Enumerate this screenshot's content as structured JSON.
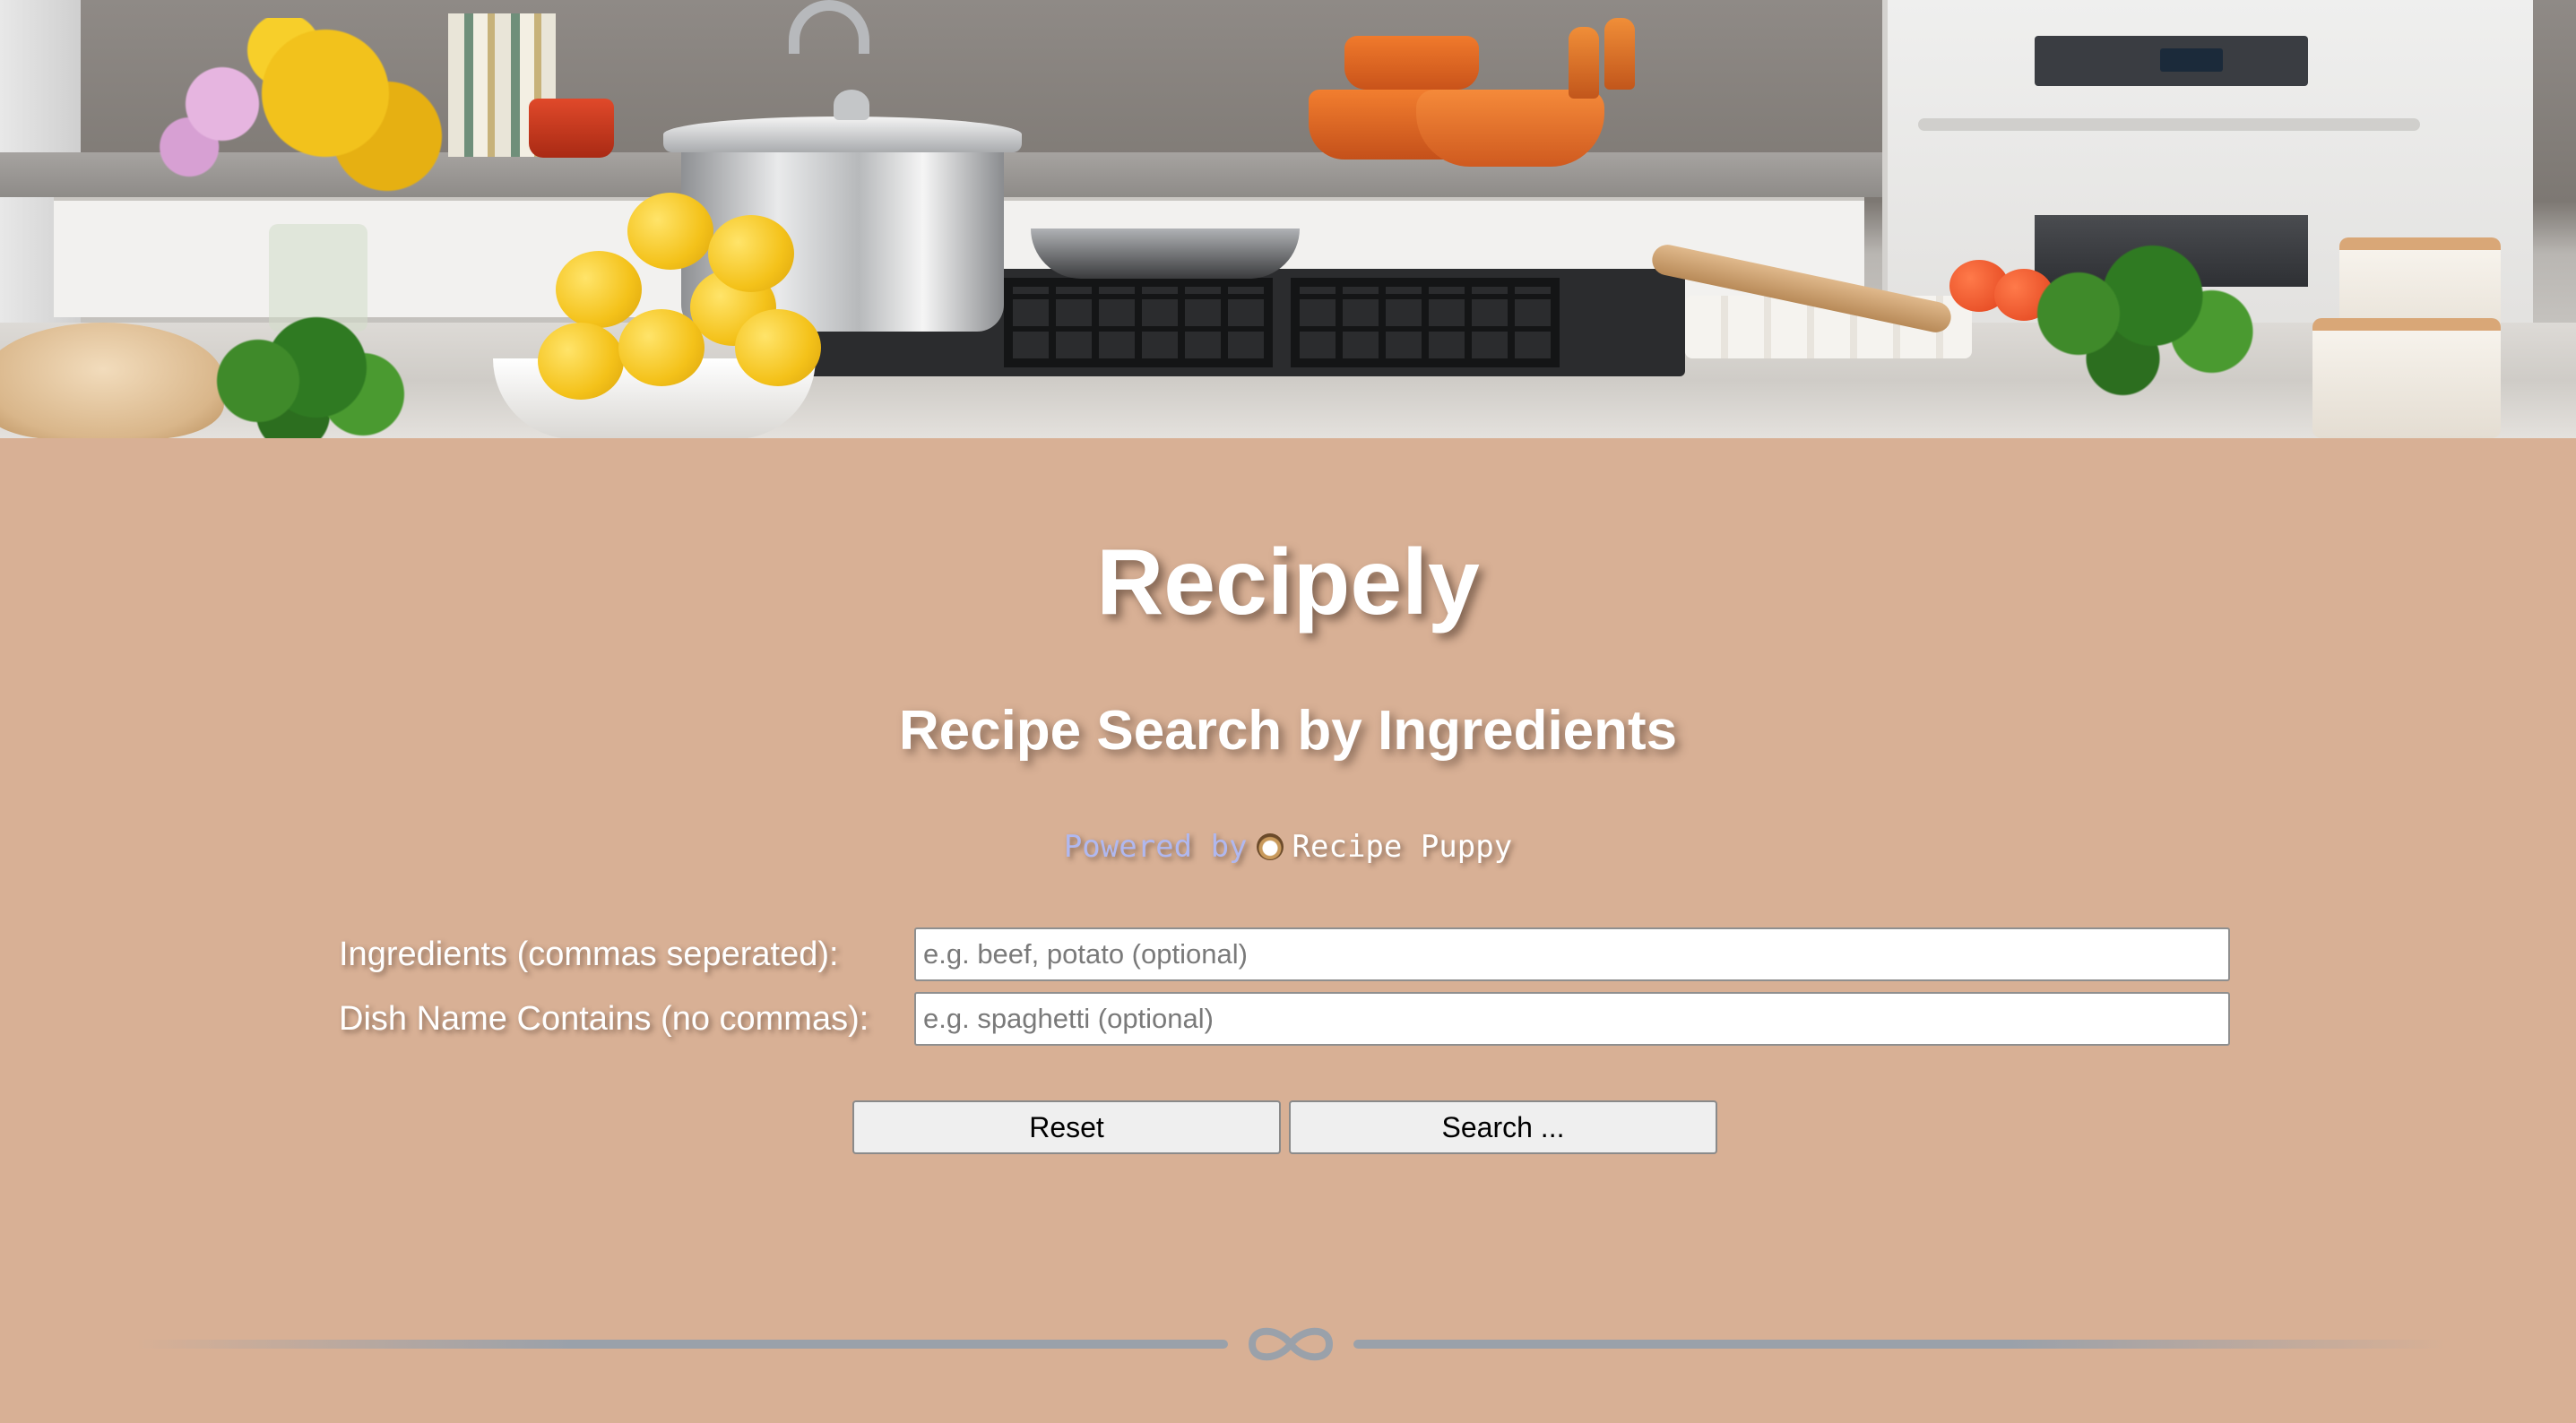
{
  "app": {
    "title": "Recipely",
    "subtitle": "Recipe Search by Ingredients"
  },
  "powered_by": {
    "prefix": "Powered by",
    "icon": "puppy-icon",
    "link_text": "Recipe Puppy"
  },
  "form": {
    "ingredients": {
      "label": "Ingredients (commas seperated):",
      "value": "",
      "placeholder": "e.g. beef, potato (optional)"
    },
    "dish_name": {
      "label": "Dish Name Contains (no commas):",
      "value": "",
      "placeholder": "e.g. spaghetti (optional)"
    },
    "reset_label": "Reset",
    "search_label": "Search ..."
  },
  "footer": {
    "divider_icon": "infinity-icon"
  },
  "colors": {
    "background": "#d8b095",
    "heading_text": "#ffffff",
    "powered_prefix": "#b0b8f0",
    "divider": "#9aa1aa"
  },
  "hero": {
    "image": "kitchen-banner"
  }
}
